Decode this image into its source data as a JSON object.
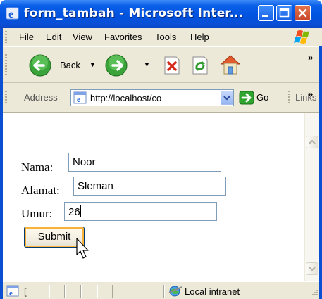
{
  "window": {
    "title": "form_tambah - Microsoft Inter..."
  },
  "menu": [
    "File",
    "Edit",
    "View",
    "Favorites",
    "Tools",
    "Help"
  ],
  "toolbar": {
    "back_label": "Back"
  },
  "address": {
    "label": "Address",
    "url": "http://localhost/co",
    "go_label": "Go",
    "links_label": "Links"
  },
  "form": {
    "nama_label": "Nama:",
    "nama_value": "Noor",
    "alamat_label": "Alamat:",
    "alamat_value": "Sleman",
    "umur_label": "Umur:",
    "umur_value": "26",
    "submit_label": "Submit"
  },
  "status": {
    "text": "[",
    "zone": "Local intranet"
  },
  "colors": {
    "titlebar": "#0a5fe8",
    "chrome": "#ece9d8",
    "accent_border": "#7f9db9",
    "button_focus": "#f8b23a"
  },
  "icons": [
    "ie-icon",
    "minimize-icon",
    "maximize-icon",
    "close-icon",
    "windows-logo-icon",
    "back-arrow-icon",
    "forward-arrow-icon",
    "stop-icon",
    "refresh-icon",
    "home-icon",
    "page-icon",
    "dropdown-arrow-icon",
    "go-arrow-icon",
    "mouse-cursor-icon",
    "globe-status-icon"
  ]
}
